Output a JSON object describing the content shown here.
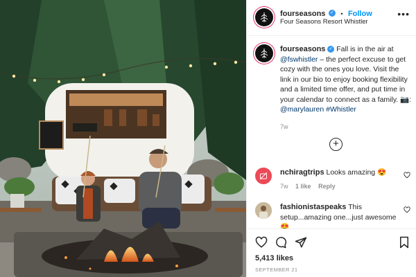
{
  "post_header": {
    "username": "fourseasons",
    "verified_glyph": "✓",
    "separator": "•",
    "follow_label": "Follow",
    "location": "Four Seasons Resort Whistler",
    "more_icon": "more-options-icon"
  },
  "caption": {
    "username": "fourseasons",
    "text_1": " Fall is in the air at ",
    "mention_1": "@fswhistler",
    "text_2": " – the perfect excuse to get cozy with the ones you love. Visit the link in our bio to enjoy booking flexibility and a limited time offer, and put time in your calendar to connect as a family. 📷: ",
    "mention_2": "@marylauren",
    "hashtag": "#Whistler",
    "time": "7w"
  },
  "load_more_glyph": "+",
  "comments": [
    {
      "username": "nchiragtrips",
      "text": "Looks amazing 😍",
      "time": "7w",
      "likes": "1 like",
      "reply": "Reply"
    },
    {
      "username": "fashionistaspeaks",
      "text": "This setup...amazing one...just awesome 😍"
    }
  ],
  "footer": {
    "likes": "5,413 likes",
    "date": "SEPTEMBER 21"
  },
  "colors": {
    "link": "#00376b",
    "follow": "#0095f6",
    "verified": "#3897f0",
    "secondary_text": "#8e8e8e",
    "avatar_bg": "#111111",
    "comment_avatar_1": "#ed4956"
  }
}
